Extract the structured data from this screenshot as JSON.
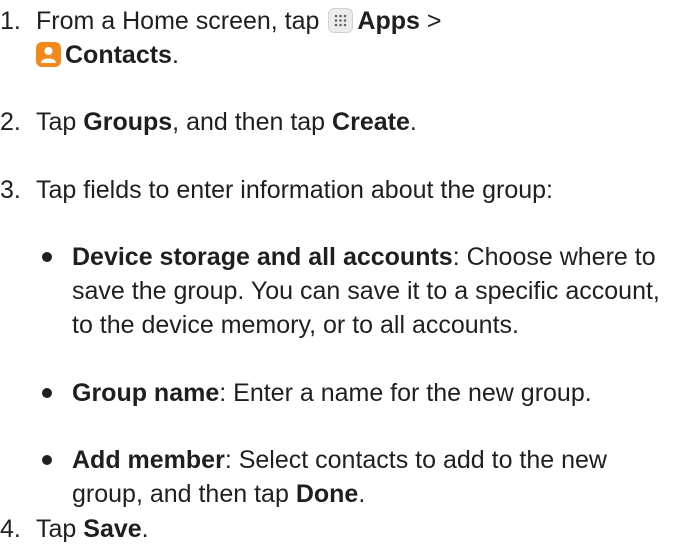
{
  "steps": [
    {
      "num": "1.",
      "pre": "From a Home screen, tap",
      "apps": "Apps",
      "sep": ">",
      "contacts": "Contacts",
      "end": "."
    },
    {
      "num": "2.",
      "pre": "Tap",
      "b1": "Groups",
      "mid": ", and then tap",
      "b2": "Create",
      "end": "."
    },
    {
      "num": "3.",
      "text": "Tap fields to enter information about the group:"
    },
    {
      "num": "4.",
      "pre": "Tap",
      "b1": "Save",
      "end": "."
    }
  ],
  "bullets": [
    {
      "label": "Device storage and all accounts",
      "text": ": Choose where to save the group. You can save it to a specific account, to the device memory, or to all accounts."
    },
    {
      "label": "Group name",
      "text": ": Enter a name for the new group."
    },
    {
      "label": "Add member",
      "text": ": Select contacts to add to the new group, and then tap",
      "b": "Done",
      "end": "."
    }
  ],
  "icons": {
    "apps": "apps-grid-icon",
    "contacts": "contacts-person-icon",
    "contacts_color": "#f08a1c"
  }
}
